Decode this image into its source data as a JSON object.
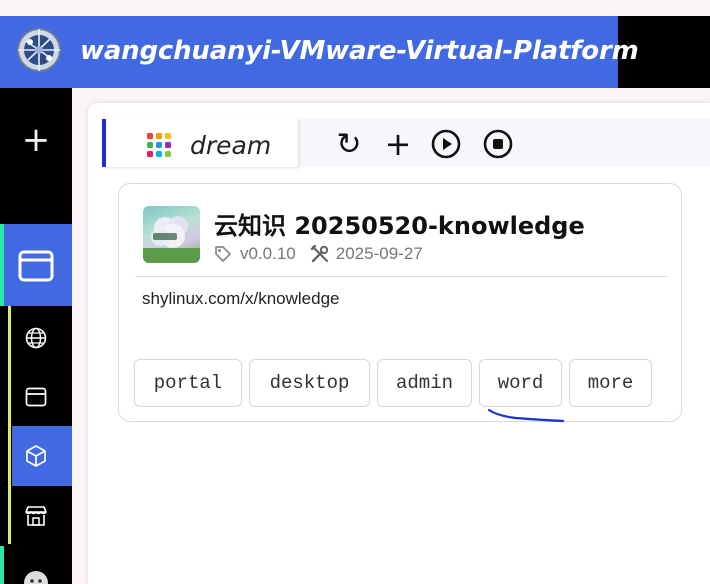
{
  "header": {
    "title": "wangchuanyi-VMware-Virtual-Platform",
    "logo_icon": "globe-icon",
    "bg_color": "#4169e1"
  },
  "sidebar": {
    "add_label": "+",
    "items": [
      {
        "icon": "window-icon",
        "active": true
      },
      {
        "icon": "globe-icon"
      },
      {
        "icon": "window-icon"
      },
      {
        "icon": "cube-icon",
        "active": true
      },
      {
        "icon": "store-icon"
      },
      {
        "icon": "smiley-icon"
      }
    ],
    "active_color": "#4169e1",
    "accent_color": "#2ee6a8"
  },
  "tabs": [
    {
      "label": "dream",
      "icon": "grid-apps-icon",
      "active": true
    }
  ],
  "toolbar": {
    "refresh_icon": "↻",
    "add_icon": "+",
    "start_icon": "play-icon",
    "stop_icon": "stop-icon"
  },
  "card": {
    "name": "云知识  20250520-knowledge",
    "version": "v0.0.10",
    "date": "2025-09-27",
    "url": "shylinux.com/x/knowledge",
    "links": [
      "portal",
      "desktop",
      "admin",
      "word",
      "more"
    ]
  }
}
